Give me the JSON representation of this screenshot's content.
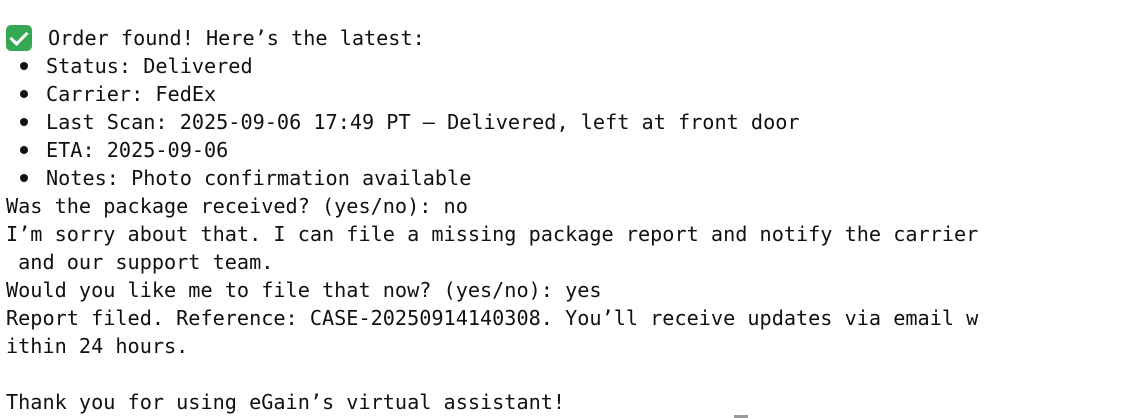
{
  "terminal": {
    "header": "Order found! Here’s the latest:",
    "header_icon": "check-mark-icon",
    "details": [
      "Status: Delivered",
      "Carrier: FedEx",
      "Last Scan: 2025-09-06 17:49 PT — Delivered, left at front door",
      "ETA: 2025-09-06",
      "Notes: Photo confirmation available"
    ],
    "prompt_received": "Was the package received? (yes/no): no",
    "apology_line1": "I’m sorry about that. I can file a missing package report and notify the carrier",
    "apology_line2": " and our support team.",
    "prompt_file": "Would you like me to file that now? (yes/no): yes",
    "report_line1": "Report filed. Reference: CASE-20250914140308. You’ll receive updates via email w",
    "report_line2": "ithin 24 hours.",
    "thanks": "Thank you for using eGain’s virtual assistant!"
  }
}
